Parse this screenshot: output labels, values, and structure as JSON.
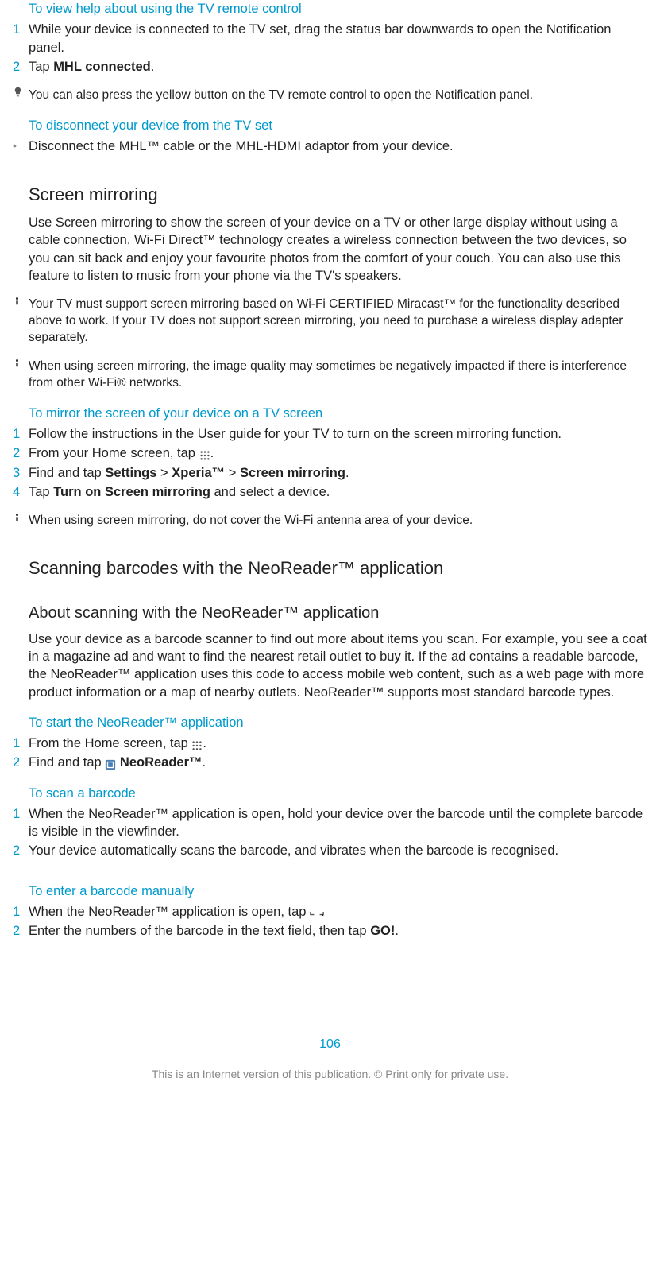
{
  "sec_view_help": {
    "heading": "To view help about using the TV remote control",
    "step1_num": "1",
    "step1": "While your device is connected to the TV set, drag the status bar downwards to open the Notification panel.",
    "step2_num": "2",
    "step2_pre": "Tap ",
    "step2_bold": "MHL connected",
    "step2_post": ".",
    "tip": "You can also press the yellow button on the TV remote control to open the Notification panel."
  },
  "sec_disconnect": {
    "heading": "To disconnect your device from the TV set",
    "bullet_text": "Disconnect the MHL™ cable or the MHL-HDMI adaptor from your device."
  },
  "sec_mirroring": {
    "heading": "Screen mirroring",
    "para": "Use Screen mirroring to show the screen of your device on a TV or other large display without using a cable connection. Wi-Fi Direct™ technology creates a wireless connection between the two devices, so you can sit back and enjoy your favourite photos from the comfort of your couch. You can also use this feature to listen to music from your phone via the TV's speakers.",
    "warn1": "Your TV must support screen mirroring based on Wi-Fi CERTIFIED Miracast™ for the functionality described above to work. If your TV does not support screen mirroring, you need to purchase a wireless display adapter separately.",
    "warn2": "When using screen mirroring, the image quality may sometimes be negatively impacted if there is interference from other Wi-Fi® networks."
  },
  "sec_mirror_steps": {
    "heading": "To mirror the screen of your device on a TV screen",
    "s1_num": "1",
    "s1": "Follow the instructions in the User guide for your TV to turn on the screen mirroring function.",
    "s2_num": "2",
    "s2_pre": "From your Home screen, tap ",
    "s2_post": ".",
    "s3_num": "3",
    "s3_pre": "Find and tap ",
    "s3_b1": "Settings",
    "s3_m1": " > ",
    "s3_b2": "Xperia™",
    "s3_m2": " > ",
    "s3_b3": "Screen mirroring",
    "s3_post": ".",
    "s4_num": "4",
    "s4_pre": "Tap ",
    "s4_b": "Turn on Screen mirroring",
    "s4_post": " and select a device.",
    "warn": "When using screen mirroring, do not cover the Wi-Fi antenna area of your device."
  },
  "sec_neo": {
    "heading": "Scanning barcodes with the NeoReader™ application",
    "sub": "About scanning with the NeoReader™ application",
    "para": "Use your device as a barcode scanner to find out more about items you scan. For example, you see a coat in a magazine ad and want to find the nearest retail outlet to buy it. If the ad contains a readable barcode, the NeoReader™ application uses this code to access mobile web content, such as a web page with more product information or a map of nearby outlets. NeoReader™ supports most standard barcode types."
  },
  "sec_start_neo": {
    "heading": "To start the NeoReader™ application",
    "s1_num": "1",
    "s1_pre": "From the Home screen, tap ",
    "s1_post": ".",
    "s2_num": "2",
    "s2_pre": "Find and tap ",
    "s2_b": " NeoReader™",
    "s2_post": "."
  },
  "sec_scan": {
    "heading": "To scan a barcode",
    "s1_num": "1",
    "s1": "When the NeoReader™ application is open, hold your device over the barcode until the complete barcode is visible in the viewfinder.",
    "s2_num": "2",
    "s2": "Your device automatically scans the barcode, and vibrates when the barcode is recognised."
  },
  "sec_manual": {
    "heading": "To enter a barcode manually",
    "s1_num": "1",
    "s1_pre": "When the NeoReader™ application is open, tap ",
    "s1_post": ".",
    "s2_num": "2",
    "s2_pre": "Enter the numbers of the barcode in the text field, then tap ",
    "s2_b": "GO!",
    "s2_post": "."
  },
  "page_number": "106",
  "footer": "This is an Internet version of this publication. © Print only for private use."
}
